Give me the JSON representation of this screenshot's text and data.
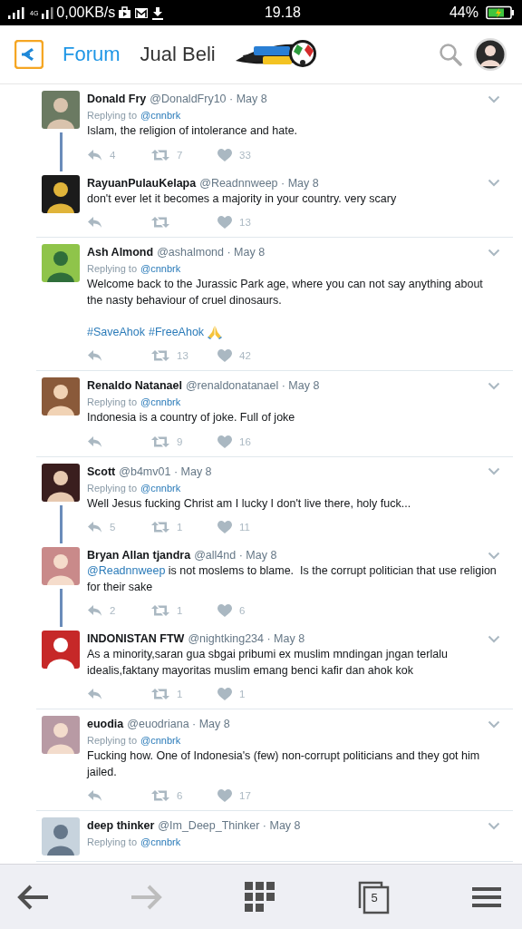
{
  "status_bar": {
    "network": "4G",
    "speed": "0,00KB/s",
    "time": "19.18",
    "battery": "44%"
  },
  "header": {
    "tabs": [
      {
        "label": "Forum",
        "selected": true
      },
      {
        "label": "Jual Beli",
        "selected": false
      }
    ]
  },
  "groups": [
    {
      "tweets": [
        {
          "name": "Donald Fry",
          "meta": "@DonaldFry10 · May 8",
          "replying_label": "Replying to",
          "replying_to": "@cnnbrk",
          "text": "Islam, the religion of intolerance and hate.",
          "replies": "4",
          "retweets": "7",
          "likes": "33",
          "thread_line": true
        },
        {
          "name": "RayuanPulauKelapa",
          "meta": "@Readnnweep · May 8",
          "text": "don't ever let it becomes a majority in your country. very scary",
          "likes": "13",
          "thread_line": false
        }
      ]
    },
    {
      "tweets": [
        {
          "name": "Ash Almond",
          "meta": "@ashalmond · May 8",
          "replying_label": "Replying to",
          "replying_to": "@cnnbrk",
          "text": "Welcome back to the Jurassic Park age, where you can not say anything about the nasty behaviour of cruel dinosaurs.",
          "hashtags": [
            "#SaveAhok",
            "#FreeAhok"
          ],
          "praying_emoji": true,
          "retweets": "13",
          "likes": "42",
          "thread_line": false
        }
      ]
    },
    {
      "tweets": [
        {
          "name": "Renaldo Natanael",
          "meta": "@renaldonatanael · May 8",
          "replying_label": "Replying to",
          "replying_to": "@cnnbrk",
          "text": "Indonesia is a country of joke. Full of joke",
          "retweets": "9",
          "likes": "16",
          "thread_line": false
        }
      ]
    },
    {
      "tweets": [
        {
          "name": "Scott",
          "meta": "@b4mv01 · May 8",
          "replying_label": "Replying to",
          "replying_to": "@cnnbrk",
          "text": "Well Jesus fucking Christ am I lucky I don't live there, holy fuck...",
          "replies": "5",
          "retweets": "1",
          "likes": "11",
          "thread_line": true
        },
        {
          "name": "Bryan Allan tjandra",
          "meta": "@all4nd · May 8",
          "mention": "@Readnnweep",
          "text": "is not moslems to blame.  Is the corrupt politician that use religion for their sake",
          "replies": "2",
          "retweets": "1",
          "likes": "6",
          "thread_line": true
        },
        {
          "name": "INDONISTAN FTW",
          "meta": "@nightking234 · May 8",
          "text": "As a minority,saran gua sbgai pribumi ex muslim mndingan jngan terlalu idealis,faktany mayoritas muslim emang benci kafir dan ahok kok",
          "retweets": "1",
          "likes": "1",
          "thread_line": false
        }
      ]
    },
    {
      "tweets": [
        {
          "name": "euodia",
          "meta": "@euodriana · May 8",
          "replying_label": "Replying to",
          "replying_to": "@cnnbrk",
          "text": "Fucking how. One of Indonesia's (few) non-corrupt politicians and they got him jailed.",
          "retweets": "6",
          "likes": "17",
          "thread_line": false
        }
      ]
    },
    {
      "tweets": [
        {
          "name": "deep thinker",
          "meta": "@Im_Deep_Thinker · May 8",
          "replying_label": "Replying to",
          "replying_to": "@cnnbrk",
          "thread_line": false
        }
      ]
    }
  ],
  "toolbar": [
    {
      "kind": "back",
      "disabled": false
    },
    {
      "kind": "forward",
      "disabled": true
    },
    {
      "kind": "apps",
      "disabled": false
    },
    {
      "kind": "tabs",
      "count": "5",
      "disabled": false
    },
    {
      "kind": "menu",
      "disabled": false
    }
  ]
}
